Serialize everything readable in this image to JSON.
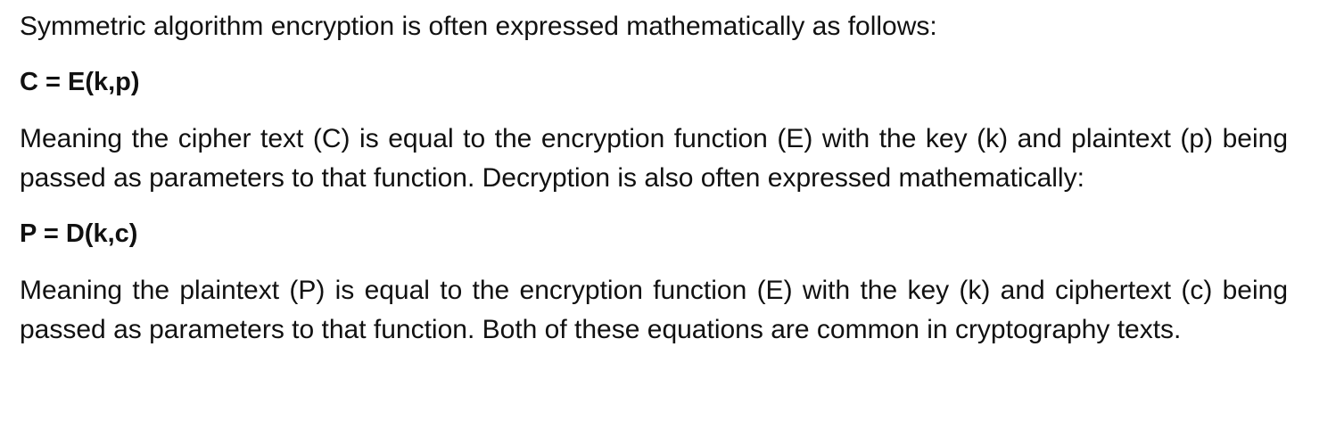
{
  "document": {
    "intro": "Symmetric algorithm encryption is often expressed mathematically as follows:",
    "equation_encrypt": "C = E(k,p)",
    "paragraph_encrypt": "Meaning the cipher text (C) is equal to the encryption function (E) with the key (k) and plaintext (p) being passed as parameters to that function. Decryption is also often expressed mathematically:",
    "equation_decrypt": "P = D(k,c)",
    "paragraph_decrypt": "Meaning the plaintext (P) is equal to the encryption function (E) with the key (k) and ciphertext (c) being passed as parameters to that function. Both of these equations are common in cryptography texts."
  }
}
